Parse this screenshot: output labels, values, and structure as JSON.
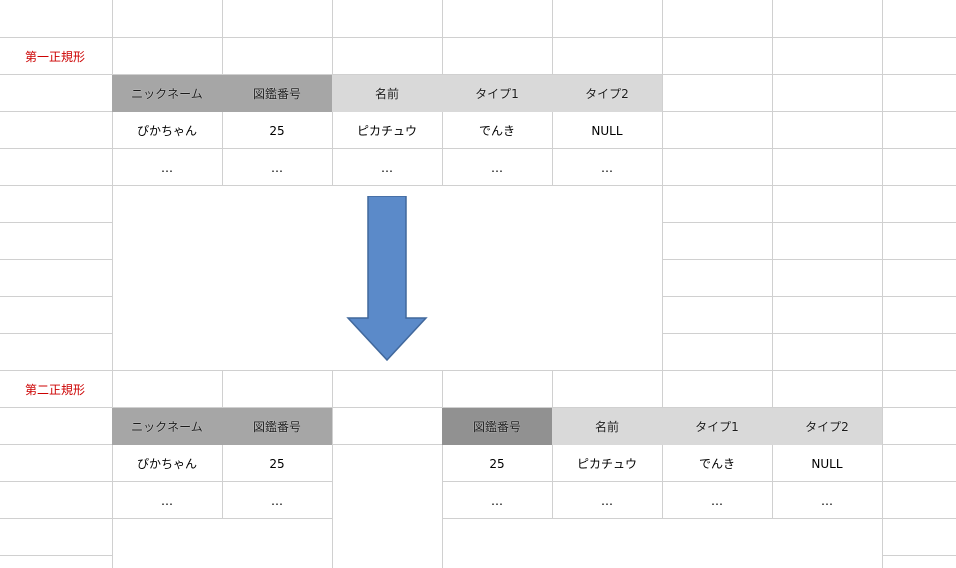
{
  "sections": {
    "first": {
      "label": "第一正規形",
      "headers": [
        "ニックネーム",
        "図鑑番号",
        "名前",
        "タイプ1",
        "タイプ2"
      ],
      "row1": [
        "ぴかちゃん",
        "25",
        "ピカチュウ",
        "でんき",
        "NULL"
      ],
      "row2": [
        "…",
        "…",
        "…",
        "…",
        "…"
      ]
    },
    "second": {
      "label": "第二正規形",
      "left_headers": [
        "ニックネーム",
        "図鑑番号"
      ],
      "left_row1": [
        "ぴかちゃん",
        "25"
      ],
      "left_row2": [
        "…",
        "…"
      ],
      "right_headers": [
        "図鑑番号",
        "名前",
        "タイプ1",
        "タイプ2"
      ],
      "right_row1": [
        "25",
        "ピカチュウ",
        "でんき",
        "NULL"
      ],
      "right_row2": [
        "…",
        "…",
        "…",
        "…"
      ]
    }
  },
  "colors": {
    "header_dark": "#a6a6a6",
    "header_darker": "#919191",
    "header_light": "#d9d9d9",
    "arrow_fill": "#5b8ac9",
    "arrow_stroke": "#41689c",
    "label_red": "#cc0000"
  },
  "arrow": {
    "direction": "down",
    "icon": "arrow-down-icon"
  }
}
